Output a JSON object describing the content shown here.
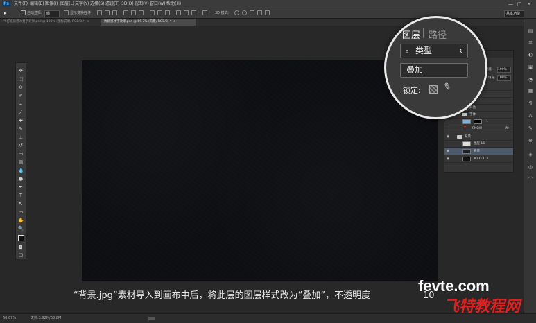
{
  "app": {
    "logo": "Ps"
  },
  "menubar": {
    "items": [
      "文件(F)",
      "编辑(E)",
      "图像(I)",
      "图层(L)",
      "文字(Y)",
      "选择(S)",
      "滤镜(T)",
      "3D(D)",
      "视图(V)",
      "窗口(W)",
      "帮助(H)"
    ],
    "window_controls": [
      "—",
      "□",
      "✕"
    ]
  },
  "options": {
    "auto_select_label": "自动选择:",
    "auto_select_value": "组",
    "show_transform_label": "显示变换控件",
    "mode3d_label": "3D 模式:",
    "workspace": "基本功能"
  },
  "tabs": [
    {
      "label": "PS打造质感冰封字效果.psd @ 100% (图标说明, RGB/8#) ×",
      "active": false
    },
    {
      "label": "抗质感冰字效果.psd @ 66.7% (背景, RGB/8) * ×",
      "active": true
    }
  ],
  "layers_panel": {
    "opacity_label": "不透明度:",
    "opacity_value": "100%",
    "fill_label": "填充:",
    "fill_value": "100%",
    "rows": [
      {
        "name": "星云",
        "kind": "group"
      },
      {
        "name": "图形",
        "kind": "group"
      },
      {
        "name": "雪",
        "kind": "group"
      },
      {
        "name": "其他",
        "kind": "group"
      },
      {
        "name": "字体",
        "kind": "group"
      },
      {
        "name": "",
        "kind": "mask-layer",
        "extra": "1"
      },
      {
        "name": "SNOW",
        "kind": "text"
      },
      {
        "name": "背景",
        "kind": "group"
      },
      {
        "name": "图层 16",
        "kind": "layer"
      },
      {
        "name": "背景",
        "kind": "layer",
        "selected": true
      },
      {
        "name": "#131313",
        "kind": "layer"
      }
    ]
  },
  "magnifier": {
    "tab_layers": "图层",
    "tab_paths": "路径",
    "filter_icon": "search-icon",
    "filter_label": "类型",
    "blend_mode": "叠加",
    "lock_label": "锁定:"
  },
  "caption": {
    "text": "“背景.jpg”素材导入到画布中后，将此层的图层样式改为“叠加”，不透明度",
    "tail": "10"
  },
  "watermark": {
    "line1": "fevte.com",
    "line2": "飞特教程网"
  },
  "statusbar": {
    "zoom": "66.67%",
    "doc": "文档:3.92M/63.8M"
  },
  "colors": {
    "canvas": "#0f1013",
    "ui_bg": "#282828",
    "panel": "#353535",
    "selected_row": "#4d5a6b",
    "watermark_red": "#e0201e"
  }
}
